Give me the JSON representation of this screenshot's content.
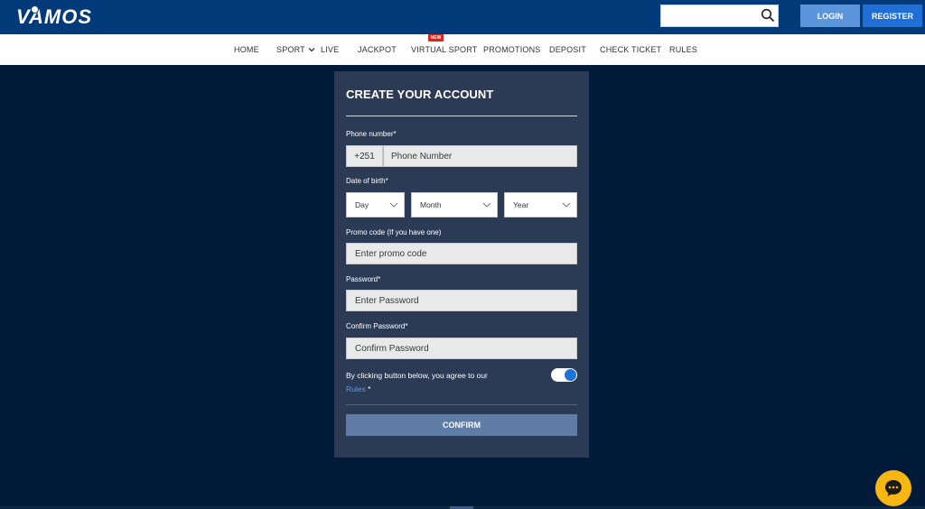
{
  "header": {
    "logo_text": "VAMOS",
    "search": {
      "placeholder": "",
      "value": ""
    },
    "login_label": "LOGIN",
    "register_label": "REGISTER"
  },
  "nav": {
    "items": [
      "HOME",
      "SPORT",
      "LIVE",
      "JACKPOT",
      "VIRTUAL SPORT",
      "PROMOTIONS",
      "DEPOSIT",
      "CHECK TICKET",
      "RULES"
    ],
    "new_badge": "NEW"
  },
  "form": {
    "title": "CREATE YOUR ACCOUNT",
    "phone_label": "Phone number*",
    "country_code": "+251",
    "phone_placeholder": "Phone Number",
    "dob_label": "Date of birth*",
    "day": "Day",
    "month": "Month",
    "year": "Year",
    "promo_label": "Promo code (If you have one)",
    "promo_placeholder": "Enter promo code",
    "password_label": "Password*",
    "password_placeholder": "Enter Password",
    "confirm_label": "Confirm Password*",
    "confirm_placeholder": "Confirm Password",
    "agree_text": "By clicking button below, you agree to our",
    "rules_link": "Rules",
    "required_mark": "*",
    "confirm_button": "CONFIRM",
    "agree_toggle_on": true
  },
  "colors": {
    "header_bg": "#033a7a",
    "page_bg": "#021b3a",
    "panel_bg": "#2c3b55",
    "login_btn": "#5b95dc",
    "register_btn": "#1f6fd6",
    "confirm_btn": "#5e7ca6",
    "chat_bubble": "#f7b712",
    "new_badge": "#d8251d"
  },
  "icons": [
    "search-icon",
    "chevron-down-icon",
    "chat-icon",
    "soccer-ball-icon"
  ]
}
